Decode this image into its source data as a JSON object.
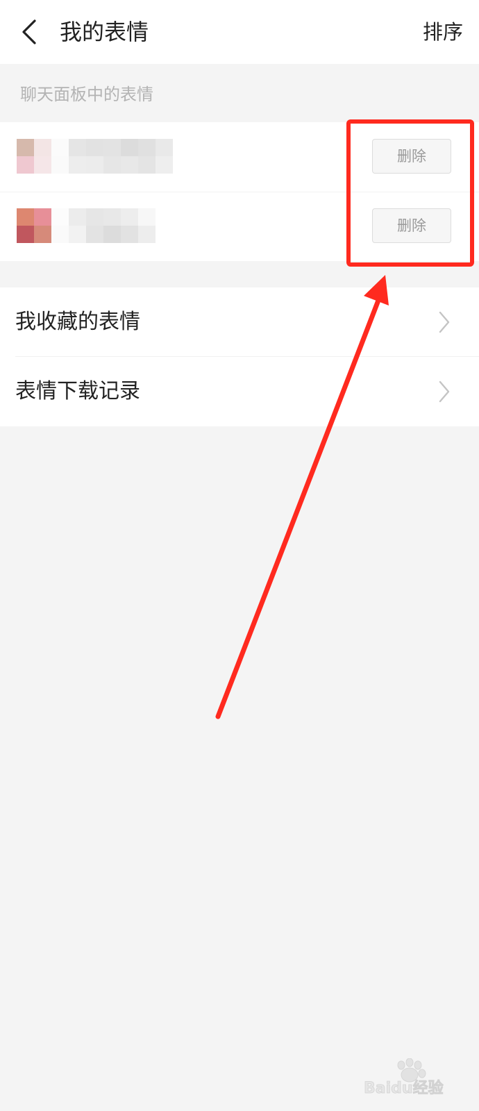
{
  "header": {
    "title": "我的表情",
    "sort_label": "排序",
    "back_icon": "chevron-left-icon"
  },
  "panel_section": {
    "label": "聊天面板中的表情",
    "rows": [
      {
        "delete_label": "删除"
      },
      {
        "delete_label": "删除"
      }
    ]
  },
  "menu": {
    "items": [
      {
        "label": "我收藏的表情",
        "icon": "chevron-right-icon"
      },
      {
        "label": "表情下载记录",
        "icon": "chevron-right-icon"
      }
    ]
  },
  "annotation": {
    "color": "#ff2a1f"
  },
  "watermark": {
    "text": "Baidu经验"
  },
  "colors": {
    "background": "#f4f4f4",
    "card": "#ffffff",
    "section_label": "#b3b3b3",
    "delete_border": "#dcdcdc",
    "delete_text": "#9a9a9a"
  }
}
